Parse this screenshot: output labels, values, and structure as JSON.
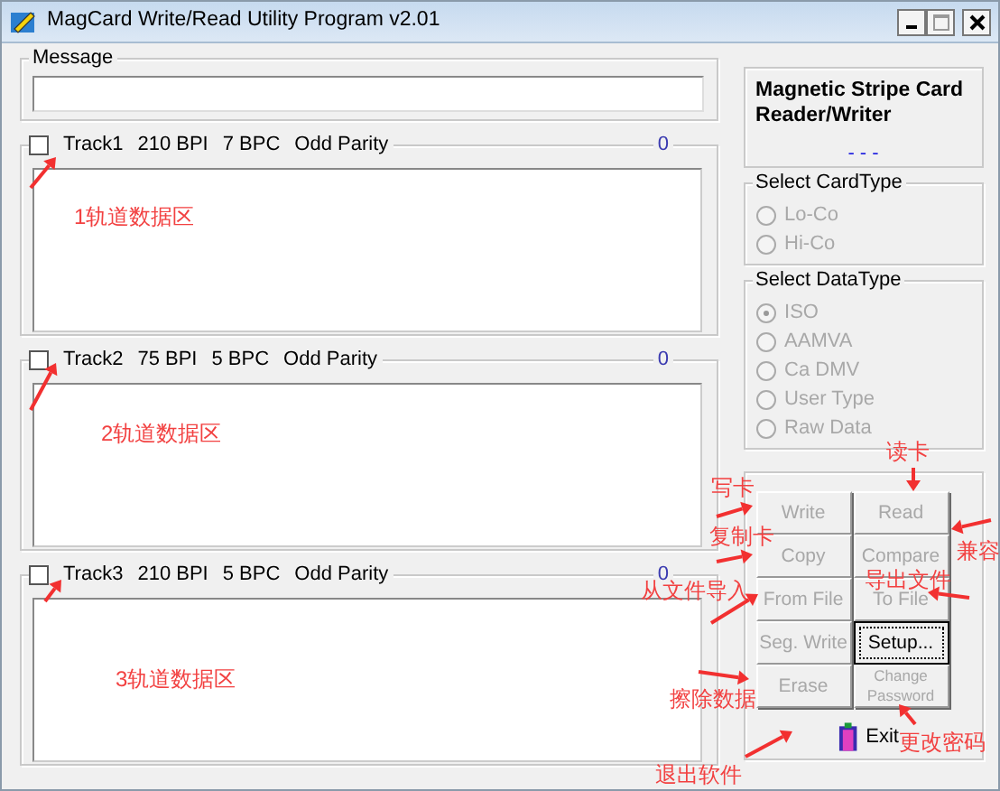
{
  "window": {
    "title": "MagCard Write/Read Utility Program v2.01"
  },
  "message": {
    "label": "Message"
  },
  "tracks": [
    {
      "label": "Track1",
      "density": "210 BPI",
      "bits": "7 BPC",
      "parity": "Odd Parity",
      "count": "0",
      "checked": false
    },
    {
      "label": "Track2",
      "density": "75 BPI",
      "bits": "5 BPC",
      "parity": "Odd Parity",
      "count": "0",
      "checked": false
    },
    {
      "label": "Track3",
      "density": "210 BPI",
      "bits": "5 BPC",
      "parity": "Odd Parity",
      "count": "0",
      "checked": false
    }
  ],
  "device": {
    "title": "Magnetic Stripe Card Reader/Writer",
    "status": "- - -"
  },
  "card_type": {
    "label": "Select CardType",
    "options": [
      {
        "label": "Lo-Co",
        "selected": false,
        "disabled": true
      },
      {
        "label": "Hi-Co",
        "selected": false,
        "disabled": true
      }
    ]
  },
  "data_type": {
    "label": "Select DataType",
    "options": [
      {
        "label": "ISO",
        "selected": true,
        "disabled": true
      },
      {
        "label": "AAMVA",
        "selected": false,
        "disabled": true
      },
      {
        "label": "Ca DMV",
        "selected": false,
        "disabled": true
      },
      {
        "label": "User Type",
        "selected": false,
        "disabled": true
      },
      {
        "label": "Raw Data",
        "selected": false,
        "disabled": true
      }
    ]
  },
  "buttons": [
    {
      "label": "Write",
      "disabled": true,
      "focused": false
    },
    {
      "label": "Read",
      "disabled": true,
      "focused": false
    },
    {
      "label": "Copy",
      "disabled": true,
      "focused": false
    },
    {
      "label": "Compare",
      "disabled": true,
      "focused": false
    },
    {
      "label": "From File",
      "disabled": true,
      "focused": false
    },
    {
      "label": "To File",
      "disabled": true,
      "focused": false
    },
    {
      "label": "Seg. Write",
      "disabled": true,
      "focused": false
    },
    {
      "label": "Setup...",
      "disabled": false,
      "focused": true
    },
    {
      "label": "Erase",
      "disabled": true,
      "focused": false
    },
    {
      "label": "Change Password",
      "disabled": true,
      "focused": false
    }
  ],
  "exit_button": {
    "label": "Exit"
  },
  "annotations": [
    {
      "text": "1轨道数据区"
    },
    {
      "text": "2轨道数据区"
    },
    {
      "text": "3轨道数据区"
    },
    {
      "text": "写卡"
    },
    {
      "text": "读卡"
    },
    {
      "text": "复制卡"
    },
    {
      "text": "兼容"
    },
    {
      "text": "从文件导入"
    },
    {
      "text": "导出文件"
    },
    {
      "text": "擦除数据"
    },
    {
      "text": "退出软件"
    },
    {
      "text": "更改密码"
    }
  ]
}
